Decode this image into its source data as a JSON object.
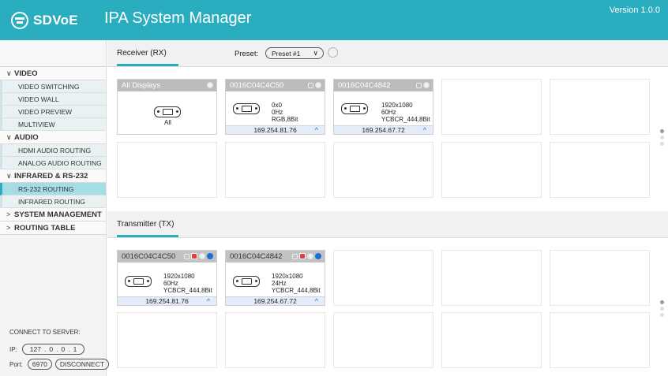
{
  "header": {
    "logo": "SDVoE",
    "title": "IPA System Manager",
    "version": "Version 1.0.0"
  },
  "sidebar": {
    "sections": [
      {
        "label": "VIDEO",
        "expanded": true,
        "items": [
          "VIDEO SWITCHING",
          "VIDEO WALL",
          "VIDEO PREVIEW",
          "MULTIVIEW"
        ]
      },
      {
        "label": "AUDIO",
        "expanded": true,
        "items": [
          "HDMI AUDIO ROUTING",
          "ANALOG AUDIO ROUTING"
        ]
      },
      {
        "label": "INFRARED & RS-232",
        "expanded": true,
        "items": [
          "RS-232 ROUTING",
          "INFRARED ROUTING"
        ]
      },
      {
        "label": "SYSTEM MANAGEMENT",
        "expanded": false,
        "items": []
      },
      {
        "label": "ROUTING TABLE",
        "expanded": false,
        "items": []
      }
    ],
    "active_item": "RS-232 ROUTING",
    "connect": {
      "title": "CONNECT TO SERVER:",
      "ip_label": "IP:",
      "ip": [
        "127",
        "0",
        "0",
        "1"
      ],
      "port_label": "Port:",
      "port": "6970",
      "disconnect": "DISCONNECT"
    }
  },
  "rx": {
    "tab": "Receiver (RX)",
    "preset_label": "Preset:",
    "preset_value": "Preset #1",
    "all_displays": {
      "title": "All Displays",
      "label": "All"
    },
    "cards": [
      {
        "id": "0016C04C4C50",
        "res": "0x0",
        "rate": "0Hz",
        "fmt": "RGB,8Bit",
        "ip": "169.254.81.76"
      },
      {
        "id": "0016C04C4842",
        "res": "1920x1080",
        "rate": "60Hz",
        "fmt": "YCBCR_444,8Bit",
        "ip": "169.254.67.72"
      }
    ]
  },
  "tx": {
    "tab": "Transmitter (TX)",
    "cards": [
      {
        "id": "0016C04C4C50",
        "res": "1920x1080",
        "rate": "60Hz",
        "fmt": "YCBCR_444,8Bit",
        "ip": "169.254.81.76"
      },
      {
        "id": "0016C04C4842",
        "res": "1920x1080",
        "rate": "24Hz",
        "fmt": "YCBCR_444,8Bit",
        "ip": "169.254.67.72"
      }
    ]
  },
  "colors": {
    "accent": "#2aaebf",
    "active_nav": "#a5dce6",
    "status_blue": "#1a6fd8",
    "status_red": "#e04040"
  }
}
